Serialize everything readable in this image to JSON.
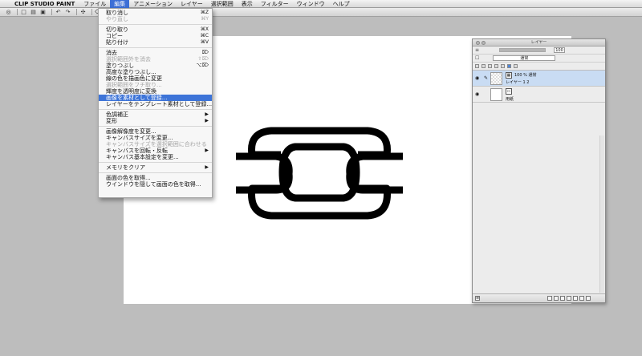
{
  "menubar": {
    "app_name": "CLIP STUDIO PAINT",
    "items": [
      "ファイル",
      "編集",
      "アニメーション",
      "レイヤー",
      "選択範囲",
      "表示",
      "フィルター",
      "ウィンドウ",
      "ヘルプ"
    ],
    "active_index": 1
  },
  "edit_menu": {
    "undo": "取り消し",
    "undo_sc": "⌘Z",
    "redo": "やり直し",
    "redo_sc": "⌘Y",
    "cut": "切り取り",
    "cut_sc": "⌘X",
    "copy": "コピー",
    "copy_sc": "⌘C",
    "paste": "貼り付け",
    "paste_sc": "⌘V",
    "clear": "消去",
    "clear_sc": "⌦",
    "clear_outside": "選択範囲外を消去",
    "clear_outside_sc": "⇧⌦",
    "fill": "塗りつぶし",
    "fill_sc": "⌥⌦",
    "advanced_fill": "高度な塗りつぶし...",
    "change_line_color": "線の色を描画色に変更",
    "stroke_selection": "選択範囲をフチ取り...",
    "lum_to_opacity": "輝度を透明度に変換",
    "register_material": "画像を素材として登録...",
    "register_template": "レイヤーをテンプレート素材として登録...",
    "tonal_correction": "色調補正",
    "transform": "変形",
    "change_resolution": "画像解像度を変更...",
    "canvas_size": "キャンバスサイズを変更...",
    "fit_canvas": "キャンバスサイズを選択範囲に合わせる",
    "rotate_canvas": "キャンバスを回転・反転",
    "canvas_settings": "キャンバス基本設定を変更...",
    "clear_memory": "メモリをクリア",
    "pick_screen_color": "画面の色を取得...",
    "hide_window_pick": "ウインドウを隠して画面の色を取得..."
  },
  "layer_panel": {
    "title": "レイヤー",
    "blend_mode": "通常",
    "opacity": "100",
    "opacity_fraction": 1.0,
    "layers": [
      {
        "info": "100 % 通常",
        "name": "レイヤー 1 2",
        "selected": true
      },
      {
        "name": "用紙",
        "selected": false
      }
    ]
  },
  "colors": {
    "menu_highlight": "#3d74d8",
    "selected_layer": "#c9dcf3",
    "canvas": "#ffffff",
    "workspace": "#bdbdbd"
  }
}
